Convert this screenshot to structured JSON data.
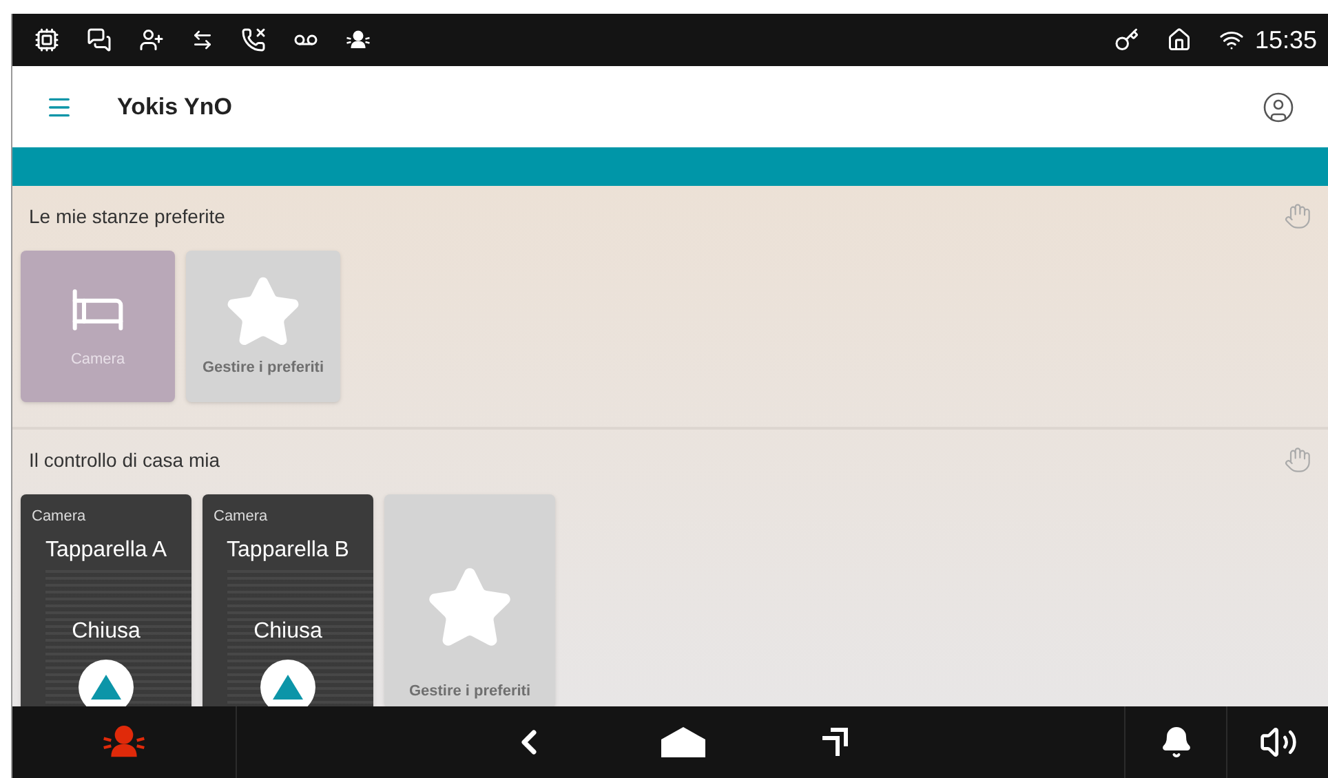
{
  "status_bar": {
    "time": "15:35"
  },
  "app_bar": {
    "title": "Yokis YnO"
  },
  "sections": [
    {
      "title": "Le mie stanze preferite",
      "tiles": [
        {
          "kind": "room",
          "label": "Camera"
        },
        {
          "kind": "manage",
          "label": "Gestire i preferiti"
        }
      ]
    },
    {
      "title": "Il controllo di casa mia",
      "tiles": [
        {
          "kind": "device",
          "room": "Camera",
          "name": "Tapparella A",
          "state": "Chiusa"
        },
        {
          "kind": "device",
          "room": "Camera",
          "name": "Tapparella B",
          "state": "Chiusa"
        },
        {
          "kind": "manage",
          "label": "Gestire i preferiti"
        }
      ]
    }
  ]
}
